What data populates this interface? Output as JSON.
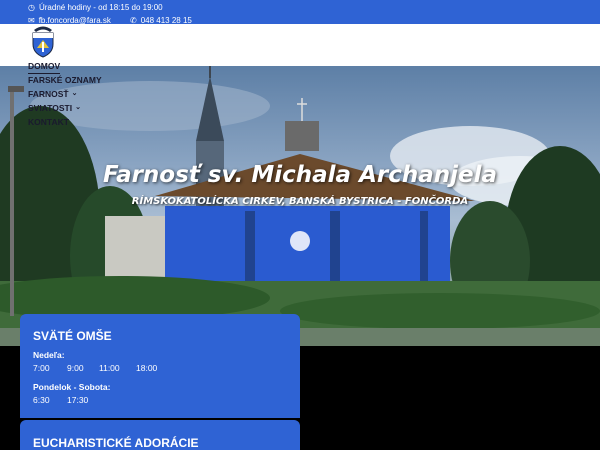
{
  "topbar": {
    "hours": "Úradné hodiny - od 18:15 do 19:00",
    "email": "fb.foncorda@fara.sk",
    "phone": "048 413 28 15"
  },
  "nav": {
    "items": [
      {
        "label": "DOMOV",
        "dropdown": false
      },
      {
        "label": "FARSKÉ OZNAMY",
        "dropdown": false
      },
      {
        "label": "FARNOSŤ",
        "dropdown": true
      },
      {
        "label": "SVIATOSTI",
        "dropdown": true
      },
      {
        "label": "KONTAKT",
        "dropdown": false
      }
    ]
  },
  "hero": {
    "title": "Farnosť sv. Michala Archanjela",
    "subtitle": "RÍMSKOKATOLÍCKA CIRKEV, BANSKÁ BYSTRICA - FONČORDA"
  },
  "masses": {
    "title": "SVÄTÉ OMŠE",
    "sunday_label": "Nedeľa:",
    "sunday_times": [
      "7:00",
      "9:00",
      "11:00",
      "18:00"
    ],
    "weekday_label": "Pondelok - Sobota:",
    "weekday_times": [
      "6:30",
      "17:30"
    ]
  },
  "adoration": {
    "title": "EUCHARISTICKÉ ADORÁCIE"
  },
  "colors": {
    "accent": "#2f63d4",
    "nav_text": "#1a1a2e",
    "church_blue": "#2a5bd0"
  }
}
